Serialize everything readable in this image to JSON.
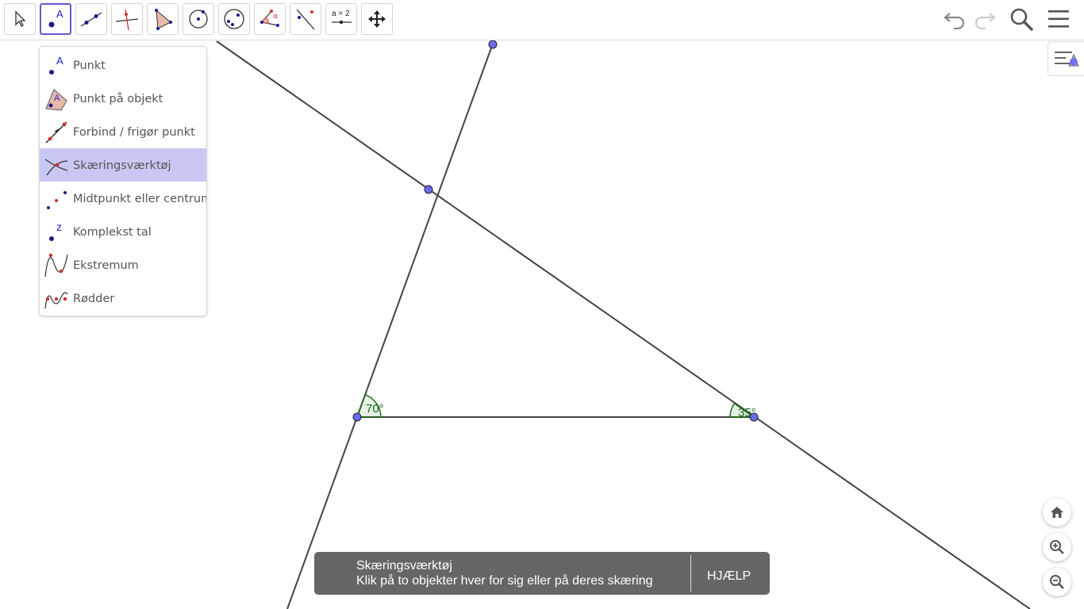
{
  "toolbar": {
    "tools": [
      {
        "name": "move-tool",
        "icon": "arrow-cursor-icon"
      },
      {
        "name": "point-tool",
        "icon": "point-icon",
        "label": "A",
        "active": true
      },
      {
        "name": "line-tool",
        "icon": "line-icon"
      },
      {
        "name": "perpendicular-tool",
        "icon": "perpendicular-icon"
      },
      {
        "name": "polygon-tool",
        "icon": "polygon-icon"
      },
      {
        "name": "circle-tool",
        "icon": "circle-icon"
      },
      {
        "name": "ellipse-tool",
        "icon": "ellipse-icon"
      },
      {
        "name": "angle-tool",
        "icon": "angle-icon",
        "label": "α"
      },
      {
        "name": "reflect-tool",
        "icon": "reflect-icon"
      },
      {
        "name": "slider-tool",
        "icon": "slider-icon",
        "label": "a = 2"
      },
      {
        "name": "move-view-tool",
        "icon": "move-graphics-icon"
      }
    ],
    "right": [
      "undo-icon",
      "redo-icon",
      "search-icon",
      "menu-icon"
    ]
  },
  "tool_menu": {
    "items": [
      {
        "label": "Punkt",
        "icon": "point-icon",
        "glyph": "A"
      },
      {
        "label": "Punkt på objekt",
        "icon": "point-on-object-icon",
        "glyph": "A"
      },
      {
        "label": "Forbind / frigør punkt",
        "icon": "attach-detach-icon"
      },
      {
        "label": "Skæringsværktøj",
        "icon": "intersect-icon",
        "selected": true
      },
      {
        "label": "Midtpunkt eller centrum",
        "icon": "midpoint-icon"
      },
      {
        "label": "Komplekst tal",
        "icon": "complex-number-icon",
        "glyph": "z"
      },
      {
        "label": "Ekstremum",
        "icon": "extremum-icon"
      },
      {
        "label": "Rødder",
        "icon": "roots-icon"
      }
    ]
  },
  "canvas": {
    "angles": [
      {
        "label": "70°",
        "name": "angle-70-label"
      },
      {
        "label": "35°",
        "name": "angle-35-label"
      }
    ]
  },
  "tooltip": {
    "title": "Skæringsværktøj",
    "description": "Klik på to objekter hver for sig eller på deres skæring",
    "help": "HJÆLP"
  },
  "colors": {
    "accent": "#6557d2",
    "point_fill": "#6b6bef",
    "line": "#444444",
    "angle": "#1a6b1a",
    "menu_selected": "#c9c8f5",
    "tooltip_bg": "#666666"
  }
}
